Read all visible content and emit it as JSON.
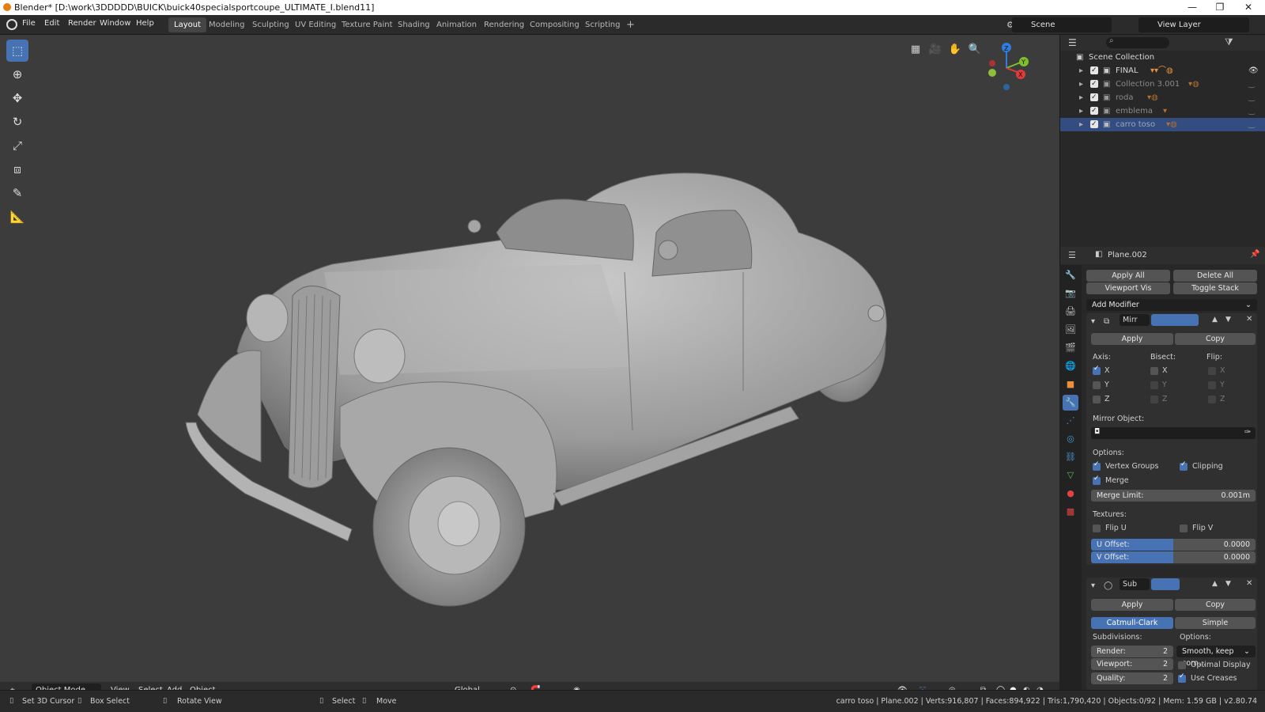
{
  "window": {
    "title": "Blender* [D:\\work\\3DDDDD\\BUICK\\buick40specialsportcoupe_ULTIMATE_I.blend11]",
    "minimize": "—",
    "maximize": "❐",
    "close": "✕"
  },
  "menu": [
    "File",
    "Edit",
    "Render",
    "Window",
    "Help"
  ],
  "workspaces": [
    "Layout",
    "Modeling",
    "Sculpting",
    "UV Editing",
    "Texture Paint",
    "Shading",
    "Animation",
    "Rendering",
    "Compositing",
    "Scripting"
  ],
  "active_workspace": "Layout",
  "add_workspace": "+",
  "scene_name": "Scene",
  "view_layer": "View Layer",
  "outliner": {
    "root": "Scene Collection",
    "items": [
      {
        "name": "FINAL"
      },
      {
        "name": "Collection 3.001"
      },
      {
        "name": "roda"
      },
      {
        "name": "emblema"
      },
      {
        "name": "carro toso"
      }
    ],
    "selected": "carro toso"
  },
  "properties": {
    "object_name": "Plane.002",
    "apply_all": "Apply All",
    "delete_all": "Delete All",
    "viewport_vis": "Viewport Vis",
    "toggle_stack": "Toggle Stack",
    "add_modifier": "Add Modifier",
    "mirror": {
      "name": "Mirr",
      "apply": "Apply",
      "copy": "Copy",
      "axis_label": "Axis:",
      "bisect_label": "Bisect:",
      "flip_label": "Flip:",
      "axes": [
        "X",
        "Y",
        "Z"
      ],
      "mirror_object_label": "Mirror Object:",
      "options_label": "Options:",
      "vertex_groups": "Vertex Groups",
      "clipping": "Clipping",
      "merge": "Merge",
      "merge_limit_label": "Merge Limit:",
      "merge_limit_value": "0.001m",
      "textures_label": "Textures:",
      "flip_u": "Flip U",
      "flip_v": "Flip V",
      "u_offset_label": "U Offset:",
      "u_offset_value": "0.0000",
      "v_offset_label": "V Offset:",
      "v_offset_value": "0.0000"
    },
    "subsurf": {
      "name": "Sub",
      "apply": "Apply",
      "copy": "Copy",
      "catmull": "Catmull-Clark",
      "simple": "Simple",
      "subdivisions_label": "Subdivisions:",
      "options_label": "Options:",
      "render_label": "Render:",
      "render_value": "2",
      "viewport_label": "Viewport:",
      "viewport_value": "2",
      "quality_label": "Quality:",
      "quality_value": "2",
      "uv_smooth": "Smooth, keep corn...",
      "optimal_display": "Optimal Display",
      "use_creases": "Use Creases"
    }
  },
  "viewport_header": {
    "mode": "Object Mode",
    "view": "View",
    "select": "Select",
    "add": "Add",
    "object": "Object",
    "orientation": "Global"
  },
  "gizmo": {
    "z": "Z",
    "y": "Y",
    "x": "X"
  },
  "statusbar": {
    "set_cursor": "Set 3D Cursor",
    "box_select": "Box Select",
    "rotate_view": "Rotate View",
    "select": "Select",
    "move": "Move",
    "stats": "carro toso | Plane.002 | Verts:916,807 | Faces:894,922 | Tris:1,790,420 | Objects:0/92 | Mem: 1.59 GB | v2.80.74"
  },
  "colors": {
    "accent": "#4772b3",
    "viewport_bg": "#3c3c3c",
    "panel_bg": "#282828",
    "blender_orange": "#e87d0d"
  }
}
